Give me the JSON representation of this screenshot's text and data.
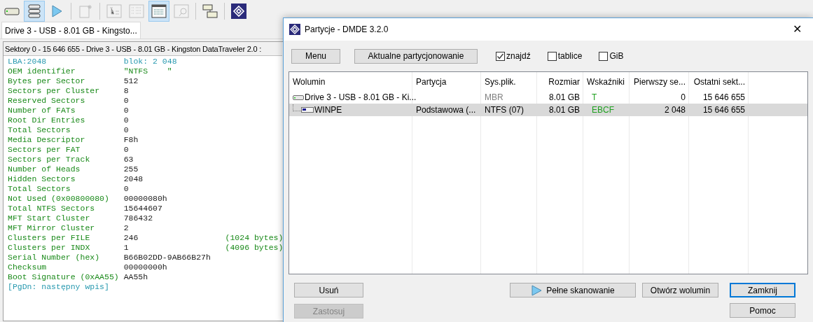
{
  "toolbar": [
    {
      "kind": "drive",
      "selected": false,
      "disabled": false
    },
    {
      "kind": "list",
      "selected": true,
      "disabled": false
    },
    {
      "kind": "play",
      "selected": false,
      "disabled": false
    },
    {
      "kind": "separator"
    },
    {
      "kind": "new",
      "selected": false,
      "disabled": true
    },
    {
      "kind": "separator"
    },
    {
      "kind": "tree",
      "selected": false,
      "disabled": true
    },
    {
      "kind": "details",
      "selected": false,
      "disabled": true
    },
    {
      "kind": "hex",
      "selected": true,
      "disabled": false
    },
    {
      "kind": "find",
      "selected": false,
      "disabled": true
    },
    {
      "kind": "separator"
    },
    {
      "kind": "copy",
      "selected": false,
      "disabled": false
    },
    {
      "kind": "separator"
    },
    {
      "kind": "logo",
      "selected": false,
      "disabled": false
    }
  ],
  "document_tab": {
    "label": "Drive 3 - USB - 8.01 GB - Kingsto...",
    "selected": true
  },
  "panel": {
    "header": "Sektory 0 - 15 646 655 - Drive 3 - USB - 8.01 GB - Kingston DataTraveler 2.0 :",
    "lines": [
      {
        "kind": "info",
        "label": "LBA:2048",
        "value": "blok: 2 048"
      },
      {
        "kind": "text",
        "label": "OEM identifier",
        "value": "\"NTFS    \""
      },
      {
        "kind": "field",
        "label": "Bytes per Sector",
        "value": "512"
      },
      {
        "kind": "field",
        "label": "Sectors per Cluster",
        "value": "8"
      },
      {
        "kind": "field",
        "label": "Reserved Sectors",
        "value": "0"
      },
      {
        "kind": "field",
        "label": "Number of FATs",
        "value": "0"
      },
      {
        "kind": "field",
        "label": "Root Dir Entries",
        "value": "0"
      },
      {
        "kind": "field",
        "label": "Total Sectors",
        "value": "0"
      },
      {
        "kind": "field",
        "label": "Media Descriptor",
        "value": "F8h"
      },
      {
        "kind": "field",
        "label": "Sectors per FAT",
        "value": "0"
      },
      {
        "kind": "field",
        "label": "Sectors per Track",
        "value": "63"
      },
      {
        "kind": "field",
        "label": "Number of Heads",
        "value": "255"
      },
      {
        "kind": "field",
        "label": "Hidden Sectors",
        "value": "2048"
      },
      {
        "kind": "field",
        "label": "Total Sectors",
        "value": "0"
      },
      {
        "kind": "field",
        "label": "Not Used (0x00800080)",
        "value": "00000080h"
      },
      {
        "kind": "field",
        "label": "Total NTFS Sectors",
        "value": "15644607"
      },
      {
        "kind": "field",
        "label": "MFT Start Cluster",
        "value": "786432"
      },
      {
        "kind": "field",
        "label": "MFT Mirror Cluster",
        "value": "2"
      },
      {
        "kind": "field",
        "label": "Clusters per FILE",
        "value": "246",
        "note": "(1024 bytes)"
      },
      {
        "kind": "field",
        "label": "Clusters per INDX",
        "value": "1",
        "note": "(4096 bytes)"
      },
      {
        "kind": "field",
        "label": "Serial Number (hex)",
        "value": "B66B02DD-9AB66B27h"
      },
      {
        "kind": "field",
        "label": "Checksum",
        "value": "00000000h"
      },
      {
        "kind": "field",
        "label": "Boot Signature (0xAA55)",
        "value": "AA55h"
      },
      {
        "kind": "hint",
        "label": "[PgDn: następny wpis]"
      }
    ]
  },
  "dialog": {
    "title": "Partycje - DMDE 3.2.0",
    "close": "✕",
    "buttons_top": [
      "Menu",
      "Aktualne partycjonowanie"
    ],
    "checkboxes": [
      {
        "label": "znajdź",
        "checked": true
      },
      {
        "label": "tablice",
        "checked": false
      },
      {
        "label": "GiB",
        "checked": false
      }
    ],
    "table": {
      "columns": [
        "Wolumin",
        "Partycja",
        "Sys.plik.",
        "Rozmiar",
        "Wskaźniki",
        "Pierwszy se...",
        "Ostatni sekt..."
      ],
      "rows": [
        {
          "kind": "disk",
          "selected": false,
          "cells": [
            "Drive 3 - USB - 8.01 GB - Ki...",
            "",
            "MBR",
            "8.01 GB",
            "T",
            "0",
            "15 646 655"
          ],
          "children": [
            {
              "kind": "partition",
              "selected": true,
              "cells": [
                "WINPE",
                "Podstawowa (...",
                "NTFS (07)",
                "8.01 GB",
                "EBCF",
                "2 048",
                "15 646 655"
              ]
            }
          ]
        }
      ]
    },
    "buttons": [
      {
        "label": "Usuń",
        "disabled": false,
        "default": false
      },
      {
        "label": "Pełne skanowanie",
        "disabled": false,
        "default": false
      },
      {
        "label": "Otwórz wolumin",
        "disabled": false,
        "default": false
      },
      {
        "label": "Zamknij",
        "disabled": false,
        "default": true
      },
      {
        "label": "Zastosuj",
        "disabled": true,
        "default": false
      },
      {
        "label": "Pomoc",
        "disabled": false,
        "default": false
      }
    ]
  }
}
